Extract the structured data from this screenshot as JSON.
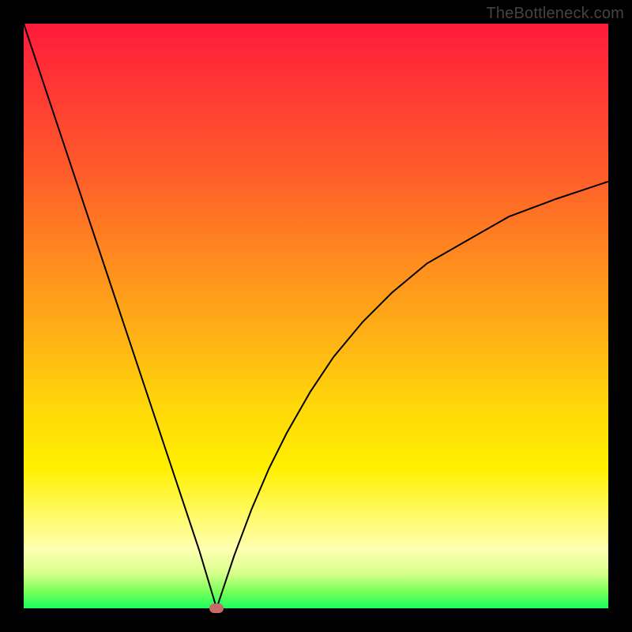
{
  "watermark": "TheBottleneck.com",
  "chart_data": {
    "type": "line",
    "title": "",
    "xlabel": "",
    "ylabel": "",
    "xlim": [
      0,
      100
    ],
    "ylim": [
      0,
      100
    ],
    "background_gradient": [
      "#ff1b3b",
      "#ff8a1f",
      "#ffd60a",
      "#fffa66",
      "#1bff60"
    ],
    "minimum_marker": {
      "x": 33,
      "y": 0,
      "color": "#c66a6a"
    },
    "series": [
      {
        "name": "bottleneck-curve",
        "x": [
          0,
          3,
          6,
          9,
          12,
          15,
          18,
          21,
          24,
          27,
          30,
          33,
          36,
          39,
          42,
          45,
          49,
          53,
          58,
          63,
          69,
          76,
          83,
          91,
          100
        ],
        "y": [
          100,
          91,
          82,
          73,
          64,
          55,
          46,
          37,
          28,
          19,
          10,
          0,
          9,
          17,
          24,
          30,
          37,
          43,
          49,
          54,
          59,
          63,
          67,
          70,
          73
        ]
      }
    ]
  }
}
